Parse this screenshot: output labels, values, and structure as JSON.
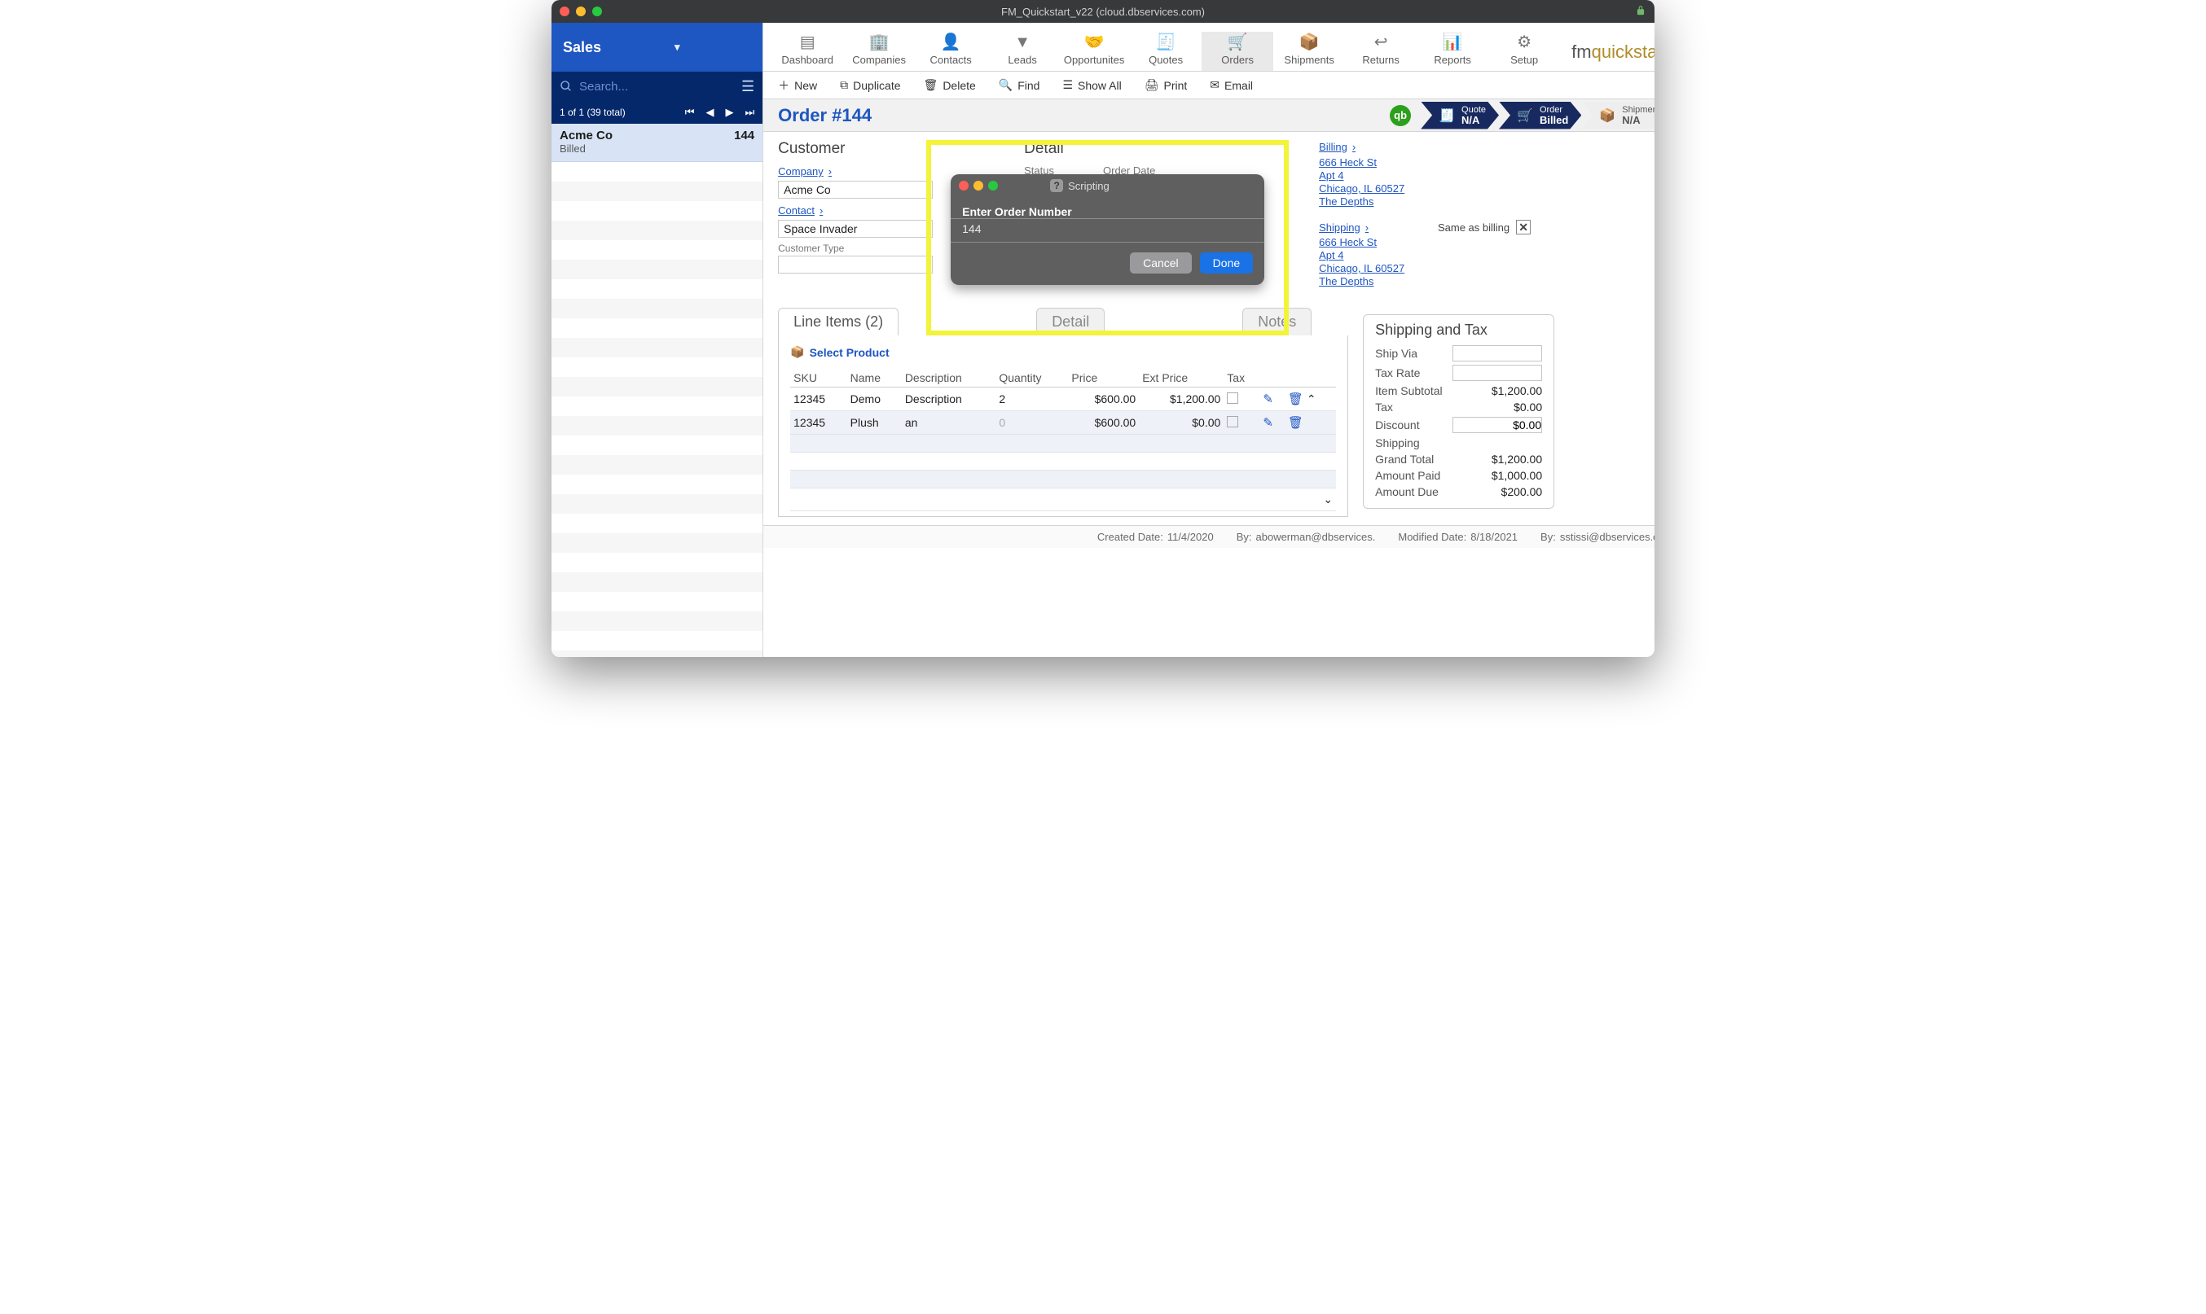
{
  "window": {
    "title": "FM_Quickstart_v22 (cloud.dbservices.com)"
  },
  "sidebar": {
    "module": "Sales",
    "search_placeholder": "Search...",
    "paging": "1 of 1 (39 total)",
    "row": {
      "company": "Acme Co",
      "idnum": "144",
      "status": "Billed"
    }
  },
  "topnav": {
    "items": [
      "Dashboard",
      "Companies",
      "Contacts",
      "Leads",
      "Opportunites",
      "Quotes",
      "Orders",
      "Shipments",
      "Returns",
      "Reports",
      "Setup"
    ],
    "brand_prefix": "fm",
    "brand_word": "quickstart"
  },
  "toolbar": {
    "new": "New",
    "duplicate": "Duplicate",
    "delete": "Delete",
    "find": "Find",
    "showall": "Show All",
    "print": "Print",
    "email": "Email"
  },
  "order_header": {
    "title": "Order #144"
  },
  "pipeline": {
    "quote": {
      "label": "Quote",
      "value": "N/A"
    },
    "order": {
      "label": "Order",
      "value": "Billed"
    },
    "shipment": {
      "label": "Shipment",
      "value": "N/A"
    }
  },
  "customer": {
    "heading": "Customer",
    "company_link": "Company",
    "company": "Acme Co",
    "contact_link": "Contact",
    "contact": "Space Invader",
    "type_label": "Customer Type"
  },
  "detail": {
    "heading": "Detail",
    "status_label": "Status",
    "orderdate_label": "Order Date"
  },
  "addresses": {
    "billing_label": "Billing",
    "shipping_label": "Shipping",
    "same_as_billing": "Same as billing",
    "lines": [
      "666 Heck St",
      "Apt 4",
      "Chicago, IL 60527",
      "The Depths"
    ]
  },
  "tabs": {
    "lineitems": "Line Items (2)",
    "detail": "Detail",
    "notes": "Notes"
  },
  "lineitems": {
    "select_product": "Select Product",
    "cols": [
      "SKU",
      "Name",
      "Description",
      "Quantity",
      "Price",
      "Ext Price",
      "Tax"
    ],
    "rows": [
      {
        "sku": "12345",
        "name": "Demo",
        "desc": "Description",
        "qty": "2",
        "price": "$600.00",
        "ext": "$1,200.00"
      },
      {
        "sku": "12345",
        "name": "Plush",
        "desc": "an",
        "qty": "0",
        "price": "$600.00",
        "ext": "$0.00"
      }
    ]
  },
  "shiptax": {
    "heading": "Shipping and Tax",
    "ship_via": "Ship Via",
    "tax_rate": "Tax Rate",
    "item_subtotal_label": "Item Subtotal",
    "item_subtotal": "$1,200.00",
    "tax_label": "Tax",
    "tax": "$0.00",
    "discount_label": "Discount",
    "discount": "$0.00",
    "shipping_label": "Shipping",
    "grand_label": "Grand Total",
    "grand": "$1,200.00",
    "paid_label": "Amount Paid",
    "paid": "$1,000.00",
    "due_label": "Amount Due",
    "due": "$200.00"
  },
  "footer": {
    "created_label": "Created Date:",
    "created_date": "11/4/2020",
    "created_by_label": "By:",
    "created_by": "abowerman@dbservices.",
    "modified_label": "Modified Date:",
    "modified_date": "8/18/2021",
    "modified_by_label": "By:",
    "modified_by": "sstissi@dbservices.com"
  },
  "dialog": {
    "scripting": "Scripting",
    "prompt": "Enter Order Number",
    "value": "144",
    "cancel": "Cancel",
    "done": "Done"
  }
}
